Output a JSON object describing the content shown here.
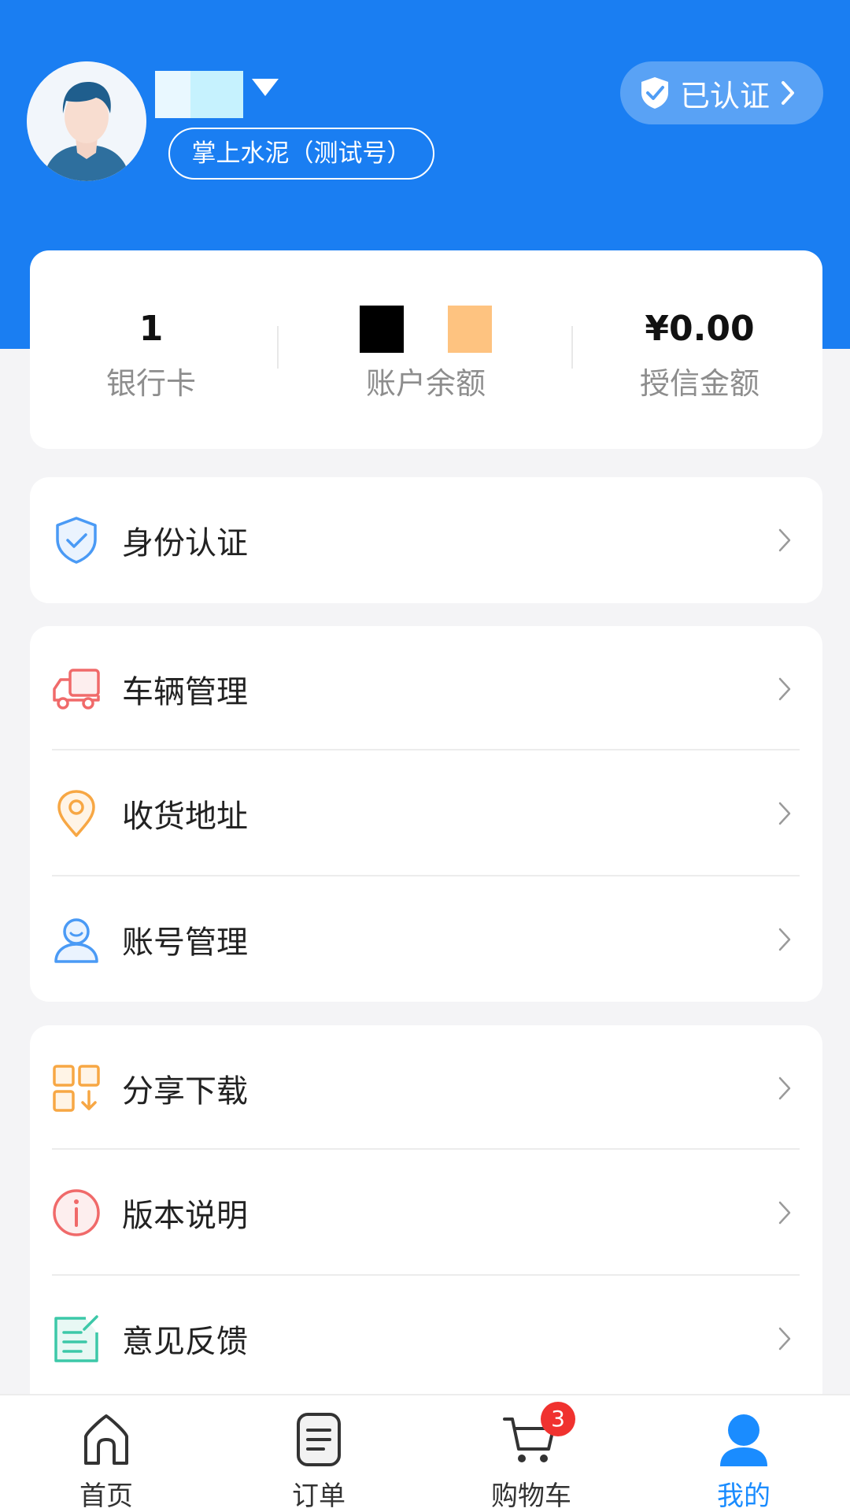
{
  "profile": {
    "company": "掌上水泥（测试号）",
    "verified_label": "已认证"
  },
  "stats": [
    {
      "value": "1",
      "label": "银行卡"
    },
    {
      "value": "",
      "label": "账户余额"
    },
    {
      "value": "¥0.00",
      "label": "授信金额"
    }
  ],
  "menu": {
    "identity": {
      "label": "身份认证",
      "icon": "shield-check-icon"
    },
    "vehicle": {
      "label": "车辆管理",
      "icon": "truck-icon"
    },
    "address": {
      "label": "收货地址",
      "icon": "location-pin-icon"
    },
    "account": {
      "label": "账号管理",
      "icon": "user-icon"
    },
    "share": {
      "label": "分享下载",
      "icon": "qr-download-icon"
    },
    "version": {
      "label": "版本说明",
      "icon": "info-icon"
    },
    "feedback": {
      "label": "意见反馈",
      "icon": "feedback-edit-icon"
    }
  },
  "tabbar": {
    "home": {
      "label": "首页"
    },
    "orders": {
      "label": "订单"
    },
    "cart": {
      "label": "购物车",
      "badge": "3"
    },
    "mine": {
      "label": "我的"
    }
  },
  "colors": {
    "header": "#1a7ef2",
    "active_tab": "#1a8cff",
    "badge": "#f0322f"
  }
}
